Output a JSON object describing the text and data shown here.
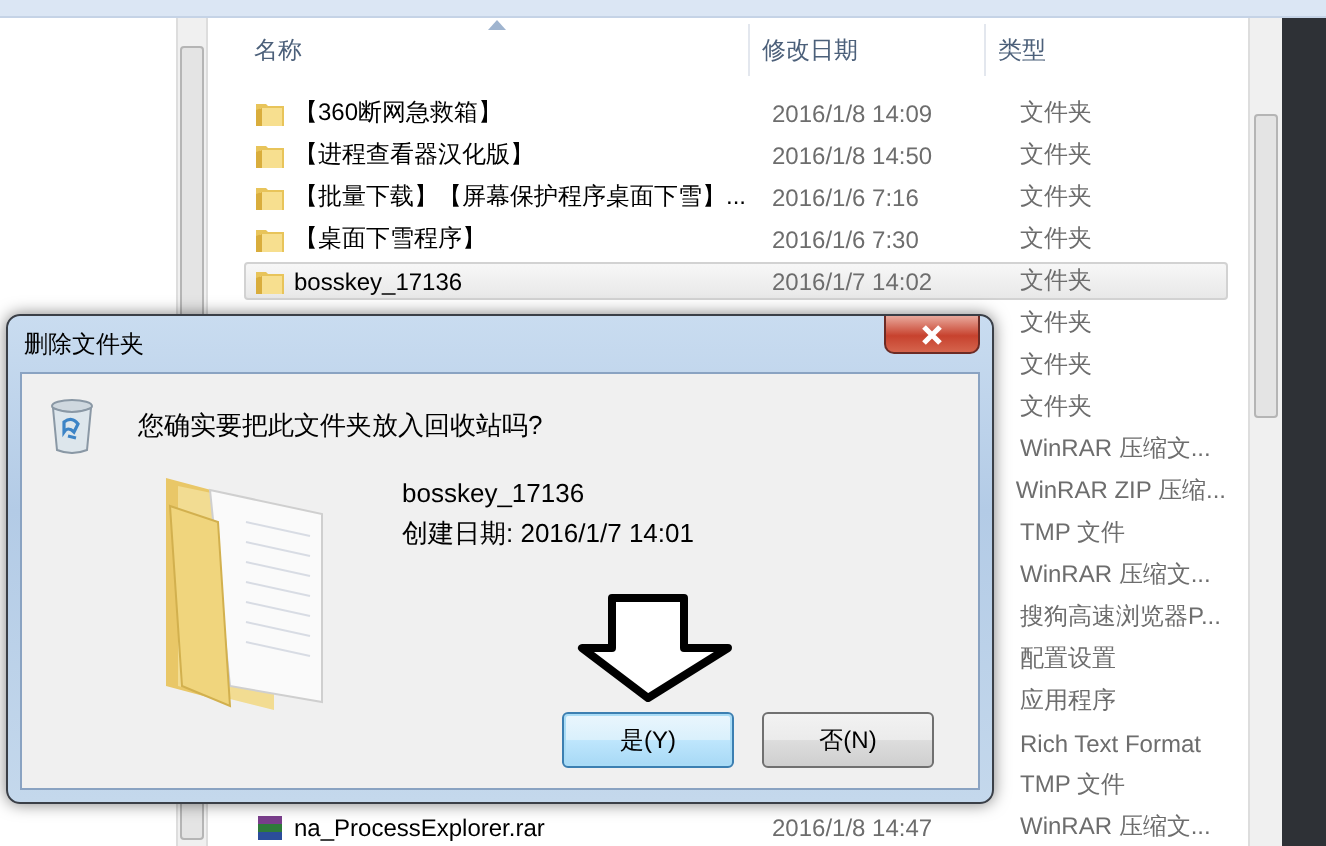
{
  "explorer": {
    "columns": [
      "名称",
      "修改日期",
      "类型"
    ],
    "rows": [
      {
        "kind": "folder",
        "name": "【360断网急救箱】",
        "date": "2016/1/8 14:09",
        "type": "文件夹",
        "selected": false
      },
      {
        "kind": "folder",
        "name": "【进程查看器汉化版】",
        "date": "2016/1/8 14:50",
        "type": "文件夹",
        "selected": false
      },
      {
        "kind": "folder",
        "name": "【批量下载】【屏幕保护程序桌面下雪】...",
        "date": "2016/1/6 7:16",
        "type": "文件夹",
        "selected": false
      },
      {
        "kind": "folder",
        "name": "【桌面下雪程序】",
        "date": "2016/1/6 7:30",
        "type": "文件夹",
        "selected": false
      },
      {
        "kind": "folder",
        "name": "bosskey_17136",
        "date": "2016/1/7 14:02",
        "type": "文件夹",
        "selected": true
      },
      {
        "type": "文件夹",
        "selected": false
      },
      {
        "type": "文件夹",
        "selected": false
      },
      {
        "type": "文件夹",
        "selected": false
      },
      {
        "type": "WinRAR 压缩文...",
        "selected": false
      },
      {
        "type": "WinRAR ZIP 压缩...",
        "selected": false
      },
      {
        "type": "TMP 文件",
        "selected": false
      },
      {
        "type": "WinRAR 压缩文...",
        "selected": false
      },
      {
        "type": "搜狗高速浏览器P...",
        "selected": false
      },
      {
        "type": "配置设置",
        "selected": false
      },
      {
        "type": "应用程序",
        "selected": false
      },
      {
        "type": "Rich Text Format",
        "selected": false
      },
      {
        "type": "TMP 文件",
        "selected": false
      },
      {
        "kind": "archive",
        "name": "na_ProcessExplorer.rar",
        "date": "2016/1/8 14:47",
        "type": "WinRAR 压缩文...",
        "selected": false
      }
    ]
  },
  "dialog": {
    "title": "删除文件夹",
    "question": "您确实要把此文件夹放入回收站吗?",
    "file_name": "bosskey_17136",
    "created": "创建日期: 2016/1/7 14:01",
    "buttons": [
      {
        "label": "是(Y)",
        "default": true
      },
      {
        "label": "否(N)",
        "default": false
      }
    ]
  }
}
